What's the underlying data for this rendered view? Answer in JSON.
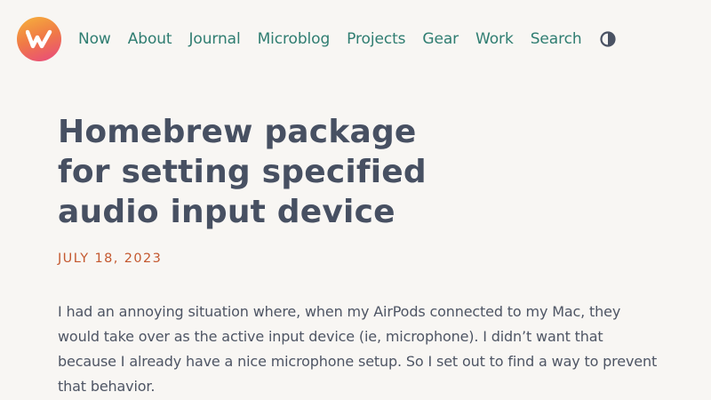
{
  "site": {
    "logo_icon": "wordmark-w-icon",
    "accent_color": "#2f7d71",
    "date_color": "#c4582f"
  },
  "nav": {
    "items": [
      {
        "label": "Now"
      },
      {
        "label": "About"
      },
      {
        "label": "Journal"
      },
      {
        "label": "Microblog"
      },
      {
        "label": "Projects"
      },
      {
        "label": "Gear"
      },
      {
        "label": "Work"
      },
      {
        "label": "Search"
      }
    ],
    "theme_toggle_icon": "half-circle-contrast-icon"
  },
  "article": {
    "title": "Homebrew package for setting specified audio input device",
    "date": "JULY 18, 2023",
    "paragraph": "I had an annoying situation where, when my AirPods connected to my Mac, they would take over as the active input device (ie, microphone). I didn’t want that because I already have a nice microphone setup. So I set out to find a way to prevent that behavior."
  }
}
